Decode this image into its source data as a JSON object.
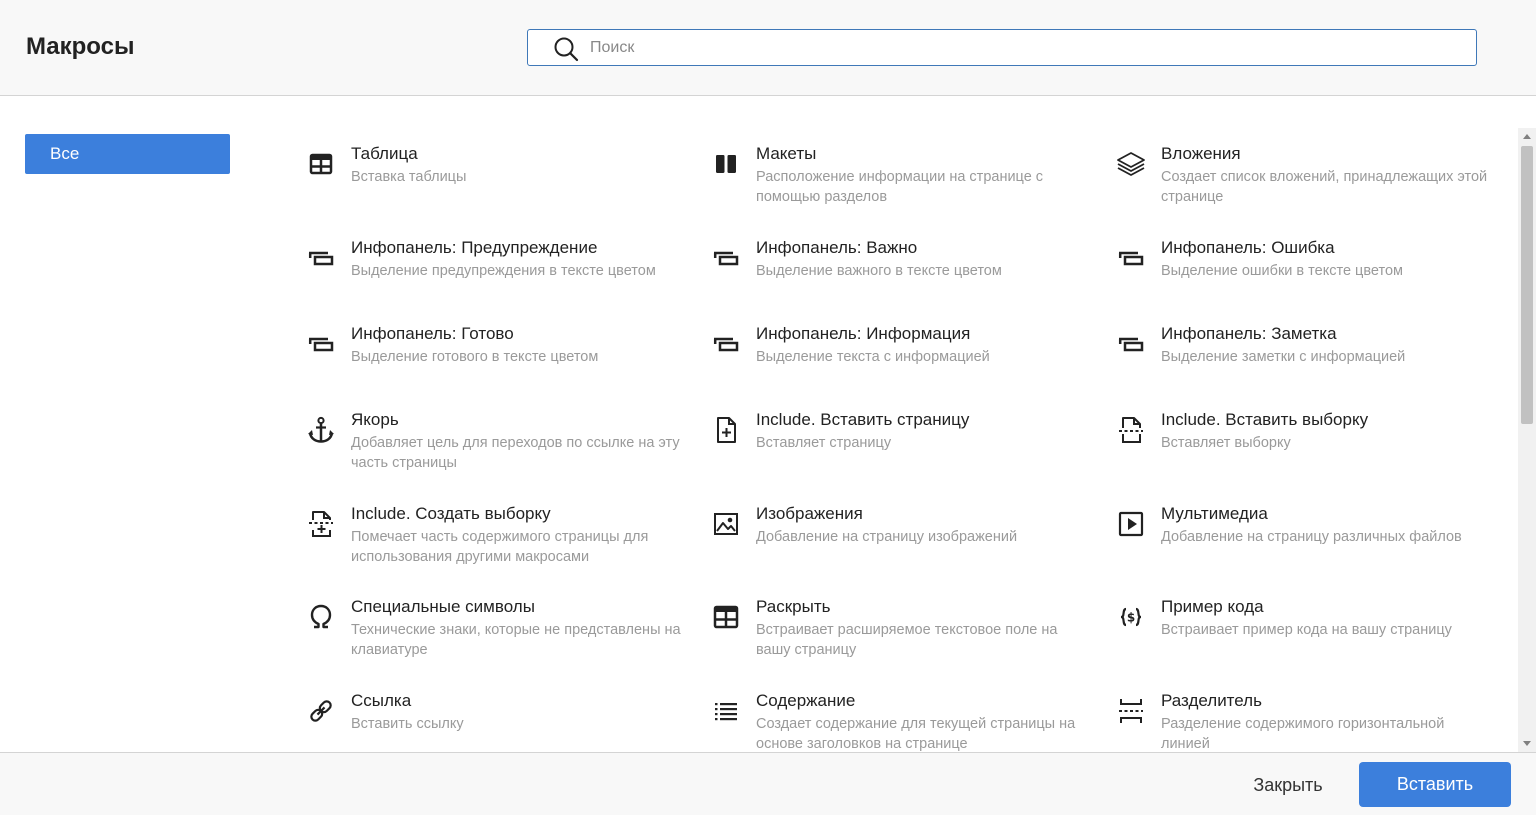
{
  "header": {
    "title": "Макросы",
    "search": {
      "placeholder": "Поиск",
      "value": ""
    }
  },
  "sidebar": {
    "categories": [
      {
        "label": "Все",
        "active": true
      }
    ]
  },
  "macros": [
    {
      "icon": "table-icon",
      "name": "Таблица",
      "desc": "Вставка таблицы"
    },
    {
      "icon": "columns-layout-icon",
      "name": "Макеты",
      "desc": "Расположение информации на странице с помощью разделов"
    },
    {
      "icon": "layers-icon",
      "name": "Вложения",
      "desc": "Создает список вложений, принадлежащих этой странице"
    },
    {
      "icon": "infopanel-icon",
      "name": "Инфопанель: Предупреждение",
      "desc": "Выделение предупреждения в тексте цветом"
    },
    {
      "icon": "infopanel-icon",
      "name": "Инфопанель: Важно",
      "desc": "Выделение важного в тексте цветом"
    },
    {
      "icon": "infopanel-icon",
      "name": "Инфопанель: Ошибка",
      "desc": "Выделение ошибки в тексте цветом"
    },
    {
      "icon": "infopanel-icon",
      "name": "Инфопанель: Готово",
      "desc": "Выделение готового в тексте цветом"
    },
    {
      "icon": "infopanel-icon",
      "name": "Инфопанель: Информация",
      "desc": "Выделение текста с информацией"
    },
    {
      "icon": "infopanel-icon",
      "name": "Инфопанель: Заметка",
      "desc": "Выделение заметки с информацией"
    },
    {
      "icon": "anchor-icon",
      "name": "Якорь",
      "desc": "Добавляет цель для переходов по ссылке на эту часть страницы"
    },
    {
      "icon": "file-plus-icon",
      "name": "Include. Вставить страницу",
      "desc": "Вставляет страницу"
    },
    {
      "icon": "file-excerpt-icon",
      "name": "Include. Вставить выборку",
      "desc": "Вставляет выборку"
    },
    {
      "icon": "file-excerpt-add-icon",
      "name": "Include. Создать выборку",
      "desc": "Помечает часть содержимого страницы для использования другими макросами"
    },
    {
      "icon": "image-icon",
      "name": "Изображения",
      "desc": "Добавление на страницу изображений"
    },
    {
      "icon": "play-icon",
      "name": "Мультимедиа",
      "desc": "Добавление на страницу различных файлов"
    },
    {
      "icon": "omega-icon",
      "name": "Специальные символы",
      "desc": "Технические знаки, которые не представлены на клавиатуре"
    },
    {
      "icon": "expand-table-icon",
      "name": "Раскрыть",
      "desc": "Встраивает расширяемое текстовое поле на вашу страницу"
    },
    {
      "icon": "code-braces-icon",
      "name": "Пример кода",
      "desc": "Встраивает пример кода на вашу страницу"
    },
    {
      "icon": "link-icon",
      "name": "Ссылка",
      "desc": "Вставить ссылку"
    },
    {
      "icon": "list-icon",
      "name": "Содержание",
      "desc": "Создает содержание для текущей страницы на основе заголовков на странице"
    },
    {
      "icon": "divider-icon",
      "name": "Разделитель",
      "desc": "Разделение содержимого горизонтальной линией"
    }
  ],
  "footer": {
    "close_label": "Закрыть",
    "insert_label": "Вставить"
  },
  "colors": {
    "accent": "#3c7fdc",
    "search_border": "#3f78b8",
    "muted_text": "#9a9a9a"
  }
}
